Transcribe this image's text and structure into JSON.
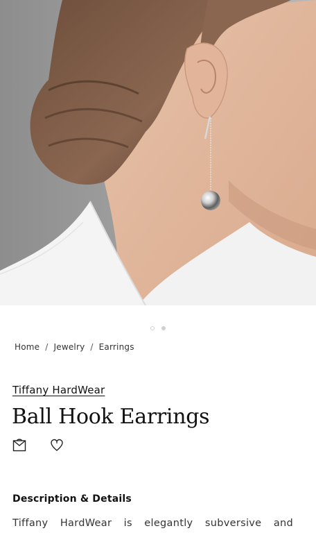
{
  "hero": {
    "image_alt": "Model wearing Tiffany HardWear ball hook earring"
  },
  "carousel": {
    "dot_count": 2,
    "active_index": 1
  },
  "breadcrumb": {
    "items": [
      "Home",
      "Jewelry",
      "Earrings"
    ],
    "separator": "/"
  },
  "product": {
    "collection": "Tiffany HardWear",
    "title": "Ball Hook Earrings"
  },
  "actions": {
    "bag_icon": "shopping-bag-icon",
    "wishlist_icon": "heart-icon"
  },
  "description": {
    "heading": "Description & Details",
    "text": "Tiffany HardWear is elegantly subversive and"
  }
}
